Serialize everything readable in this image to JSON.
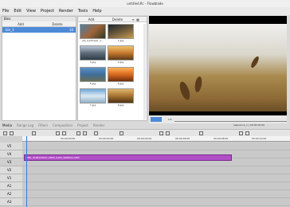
{
  "window": {
    "title": "untitled.flc - Flowblade"
  },
  "menu": [
    "File",
    "Edit",
    "View",
    "Project",
    "Render",
    "Tools",
    "Help"
  ],
  "bins": {
    "title": "Bins",
    "add": "Add",
    "delete": "Delete",
    "item": {
      "name": "bin_1",
      "count": "10"
    }
  },
  "media": {
    "add": "Add",
    "delete": "Delete",
    "clips": [
      {
        "caption": "wb_sunflower_1..."
      },
      {
        "caption": "1.jpg"
      },
      {
        "caption": "3.jpg"
      },
      {
        "caption": "4.jpg"
      },
      {
        "caption": "5.jpg"
      },
      {
        "caption": "6.jpg"
      },
      {
        "caption": "7.jpg"
      },
      {
        "caption": "8.jpg"
      }
    ]
  },
  "tabs": [
    "Media",
    "Range Log",
    "Filters",
    "Compositors",
    "Project",
    "Render"
  ],
  "preview": {
    "timecode": "1:1",
    "info": "sequence_1 | 00:00:00:00"
  },
  "timeline": {
    "ticks": [
      "00:00:00:00",
      "00:00:02:00",
      "00:00:04:00",
      "00:00:06:00",
      "00:00:08:00",
      "00:00:10:00"
    ],
    "tracks": [
      "V5",
      "V4",
      "V3",
      "V2",
      "V1",
      "A1",
      "A2",
      "A3",
      "A4"
    ],
    "clip_label": "MBL_016810WDC-CBSP_AAPS_NORMAL.MP4"
  }
}
